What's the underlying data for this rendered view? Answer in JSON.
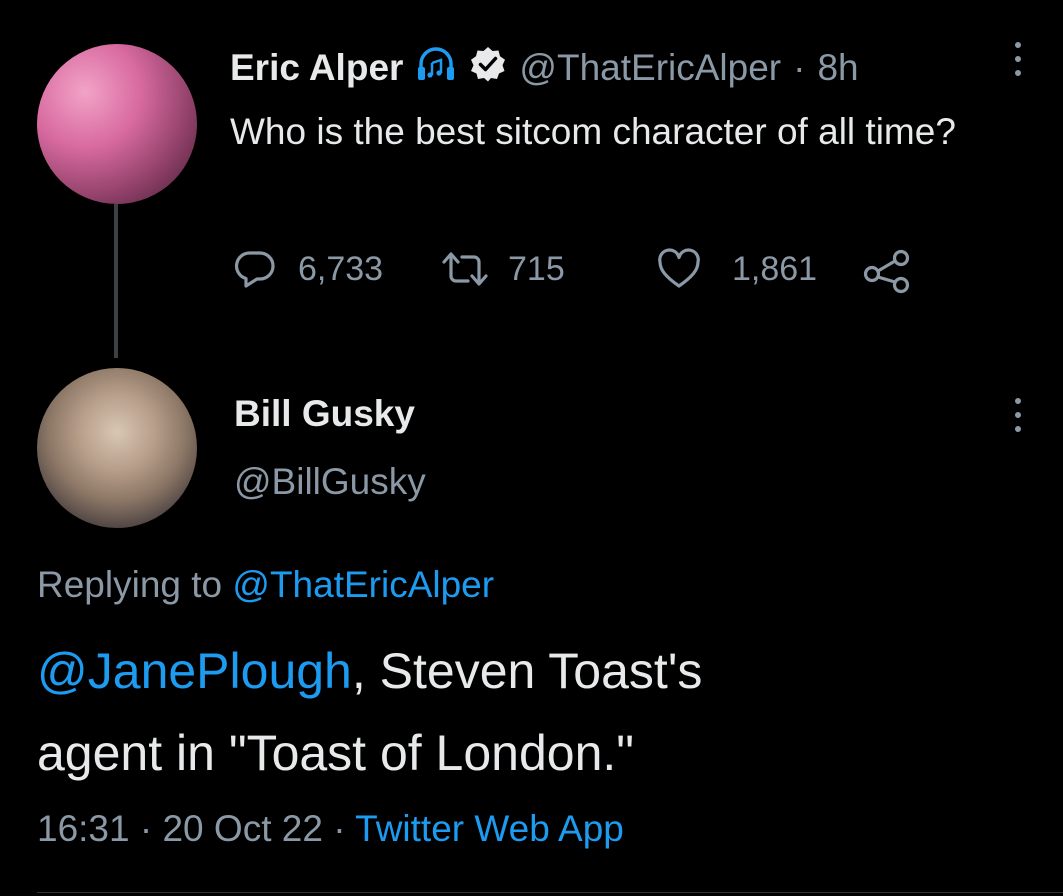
{
  "parent_tweet": {
    "author_name": "Eric Alper",
    "handle": "@ThatEricAlper",
    "separator": "·",
    "time": "8h",
    "text": "Who is the best sitcom character of all time?",
    "replies": "6,733",
    "retweets": "715",
    "likes": "1,861",
    "icons": [
      "headphones-music-icon",
      "verified-badge-icon",
      "more-options-icon",
      "reply-icon",
      "retweet-icon",
      "like-icon",
      "share-icon"
    ]
  },
  "reply_tweet": {
    "author_name": "Bill Gusky",
    "handle": "@BillGusky",
    "replying_prefix": "Replying to",
    "replying_to": "@ThatEricAlper",
    "mention": "@JanePlough",
    "text_line1": ", Steven Toast's",
    "text_line2": "agent in \"Toast of London.\"",
    "time": "16:31",
    "date": "20 Oct 22",
    "source": "Twitter Web App",
    "sep1": "·",
    "sep2": "·"
  },
  "colors": {
    "background": "#000000",
    "text": "#e7e9ea",
    "muted": "#8b98a5",
    "link": "#1d9bf0"
  }
}
